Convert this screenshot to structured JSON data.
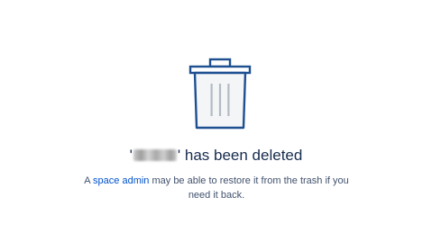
{
  "deleted_page": {
    "name_redacted": true,
    "quote_open": "'",
    "quote_close": "'",
    "title_suffix": " has been deleted"
  },
  "description": {
    "prefix": "A ",
    "link_label": "space admin",
    "suffix": " may be able to restore it from the trash if you need it back."
  },
  "icons": {
    "trash": "trash-icon"
  },
  "colors": {
    "icon_stroke": "#1d4f91",
    "link": "#0052cc",
    "title": "#172b4d",
    "body_text": "#42526e"
  }
}
